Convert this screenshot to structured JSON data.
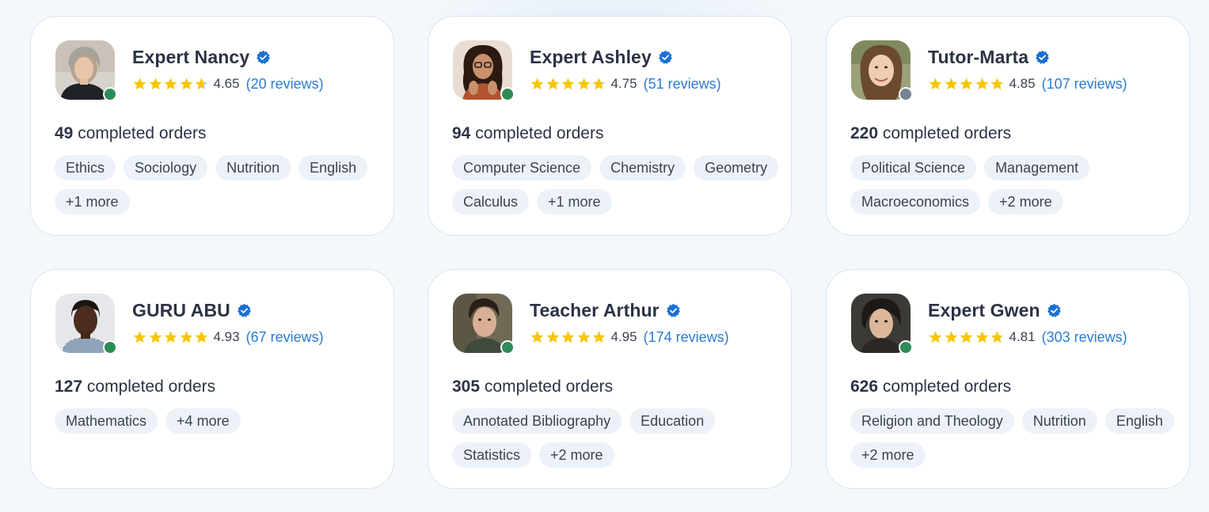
{
  "cards": [
    {
      "name": "Expert Nancy",
      "rating": "4.65",
      "rating_fraction": 0.93,
      "reviews": "(20 reviews)",
      "orders_count": "49",
      "orders_label": "completed orders",
      "status": "online",
      "tags": [
        "Ethics",
        "Sociology",
        "Nutrition",
        "English",
        "+1 more"
      ]
    },
    {
      "name": "Expert Ashley",
      "rating": "4.75",
      "rating_fraction": 0.95,
      "reviews": "(51 reviews)",
      "orders_count": "94",
      "orders_label": "completed orders",
      "status": "online",
      "tags": [
        "Computer Science",
        "Chemistry",
        "Geometry",
        "Calculus",
        "+1 more"
      ]
    },
    {
      "name": "Tutor-Marta",
      "rating": "4.85",
      "rating_fraction": 0.97,
      "reviews": "(107 reviews)",
      "orders_count": "220",
      "orders_label": "completed orders",
      "status": "offline",
      "tags": [
        "Political Science",
        "Management",
        "Macroeconomics",
        "+2 more"
      ]
    },
    {
      "name": "GURU ABU",
      "rating": "4.93",
      "rating_fraction": 0.986,
      "reviews": "(67 reviews)",
      "orders_count": "127",
      "orders_label": "completed orders",
      "status": "online",
      "tags": [
        "Mathematics",
        "+4 more"
      ]
    },
    {
      "name": "Teacher Arthur",
      "rating": "4.95",
      "rating_fraction": 0.99,
      "reviews": "(174 reviews)",
      "orders_count": "305",
      "orders_label": "completed orders",
      "status": "online",
      "tags": [
        "Annotated Bibliography",
        "Education",
        "Statistics",
        "+2 more"
      ]
    },
    {
      "name": "Expert Gwen",
      "rating": "4.81",
      "rating_fraction": 0.962,
      "reviews": "(303 reviews)",
      "orders_count": "626",
      "orders_label": "completed orders",
      "status": "online",
      "tags": [
        "Religion and Theology",
        "Nutrition",
        "English",
        "+2 more"
      ]
    }
  ],
  "icons": {
    "verified": "verified-badge-icon",
    "star": "star-icon",
    "status": "status-dot-icon"
  },
  "colors": {
    "background": "#f4f8fc",
    "card_border": "#d8e4f0",
    "star": "#f7c600",
    "star_empty": "#c9ced6",
    "verified": "#1a6fd1",
    "reviews_link": "#2a7bd4",
    "online": "#2e8b57",
    "offline": "#7b8294",
    "tag_bg": "#edf2f8"
  }
}
